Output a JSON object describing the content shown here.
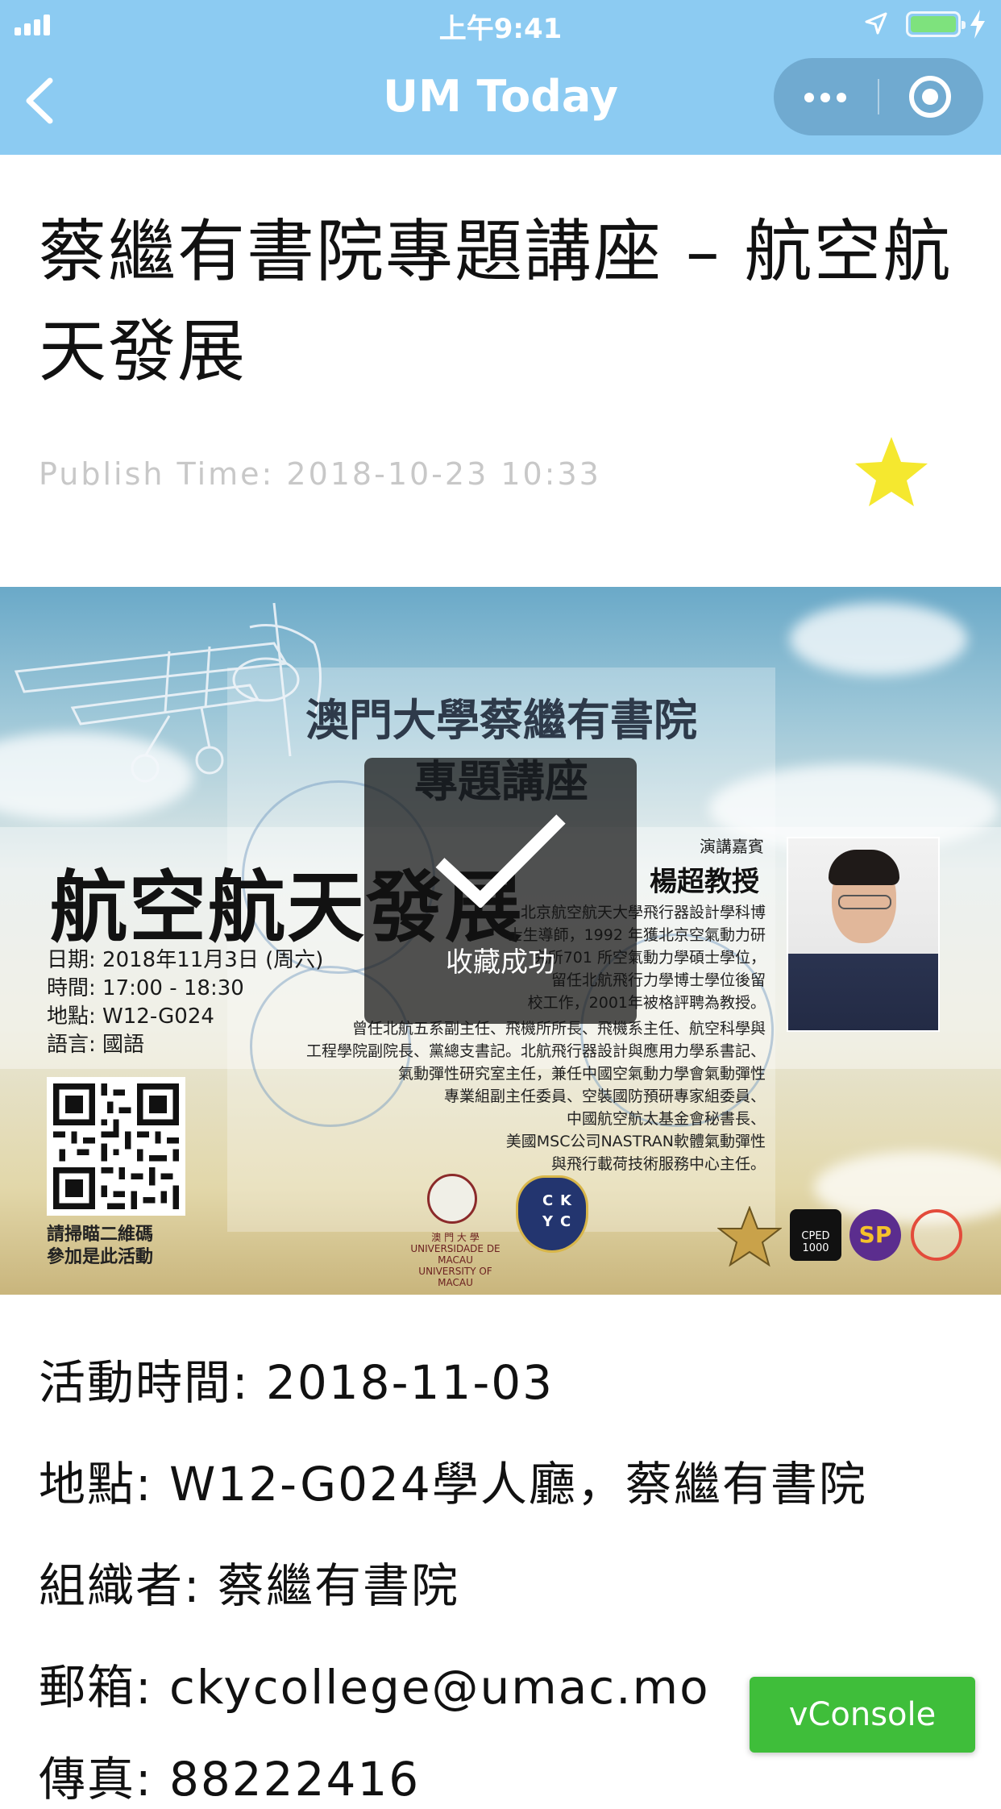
{
  "status_bar": {
    "time": "上午9:41"
  },
  "nav": {
    "title": "UM Today"
  },
  "article": {
    "title": "蔡繼有書院專題講座 – 航空航天發展",
    "publish_time": "Publish Time: 2018-10-23 10:33",
    "favorited": true
  },
  "poster": {
    "header_line1": "澳門大學蔡繼有書院",
    "header_line2": "專題講座",
    "main_title": "航空航天發展",
    "info_date": "日期: 2018年11月3日 (周六)",
    "info_time": "時間: 17:00 - 18:30",
    "info_place": "地點: W12-G024",
    "info_lang": "語言: 國語",
    "speaker_label": "演講嘉賓",
    "speaker_name": "楊超教授",
    "bio_1": "北京航空航天大學飛行器設計學科博",
    "bio_2": "士生導師，1992 年獲北京空氣動力研",
    "bio_3": "究所701 所空氣動力學碩士學位，",
    "bio_4": "留任北航飛行力學博士學位後留",
    "bio_5": "校工作，2001年被格評聘為教授。",
    "bio_6": "曾任北航五系副主任、飛機所所長、飛機系主任、航空科學與",
    "bio_7": "工程學院副院長、黨總支書記。北航飛行器設計與應用力學系書記、",
    "bio_8": "氣動彈性研究室主任，兼任中國空氣動力學會氣動彈性",
    "bio_9": "專業組副主任委員、空裝國防預研專家組委員、",
    "bio_10": "中國航空航太基金會秘書長、",
    "bio_11": "美國MSC公司NASTRAN軟體氣動彈性",
    "bio_12": "與飛行載荷技術服務中心主任。",
    "qr_caption_1": "請掃瞄二維碼",
    "qr_caption_2": "參加是此活動",
    "um_logo_text_1": "澳 門 大 學",
    "um_logo_text_2": "UNIVERSIDADE DE MACAU",
    "um_logo_text_3": "UNIVERSITY OF MACAU",
    "cky_letters": [
      "C",
      "K",
      "Y",
      "C"
    ],
    "sponsor_cped": "CPED 1000",
    "sponsor_sp": "SP"
  },
  "toast": {
    "text": "收藏成功"
  },
  "details": {
    "time": "活動時間: 2018-11-03",
    "place": "地點: W12-G024學人廳，蔡繼有書院",
    "organizer": "組織者: 蔡繼有書院",
    "email": "郵箱: ckycollege@umac.mo",
    "fax": "傳真: 88222416"
  },
  "vconsole": {
    "label": "vConsole"
  },
  "colors": {
    "nav_bg": "#8ccbf2",
    "star": "#f5e82f",
    "vconsole": "#3fbe3a"
  },
  "icons": [
    "signal-icon",
    "location-arrow-icon",
    "battery-icon",
    "charging-bolt-icon",
    "back-chevron-icon",
    "more-dots-icon",
    "close-target-icon",
    "star-icon",
    "check-icon",
    "qr-code-icon"
  ]
}
